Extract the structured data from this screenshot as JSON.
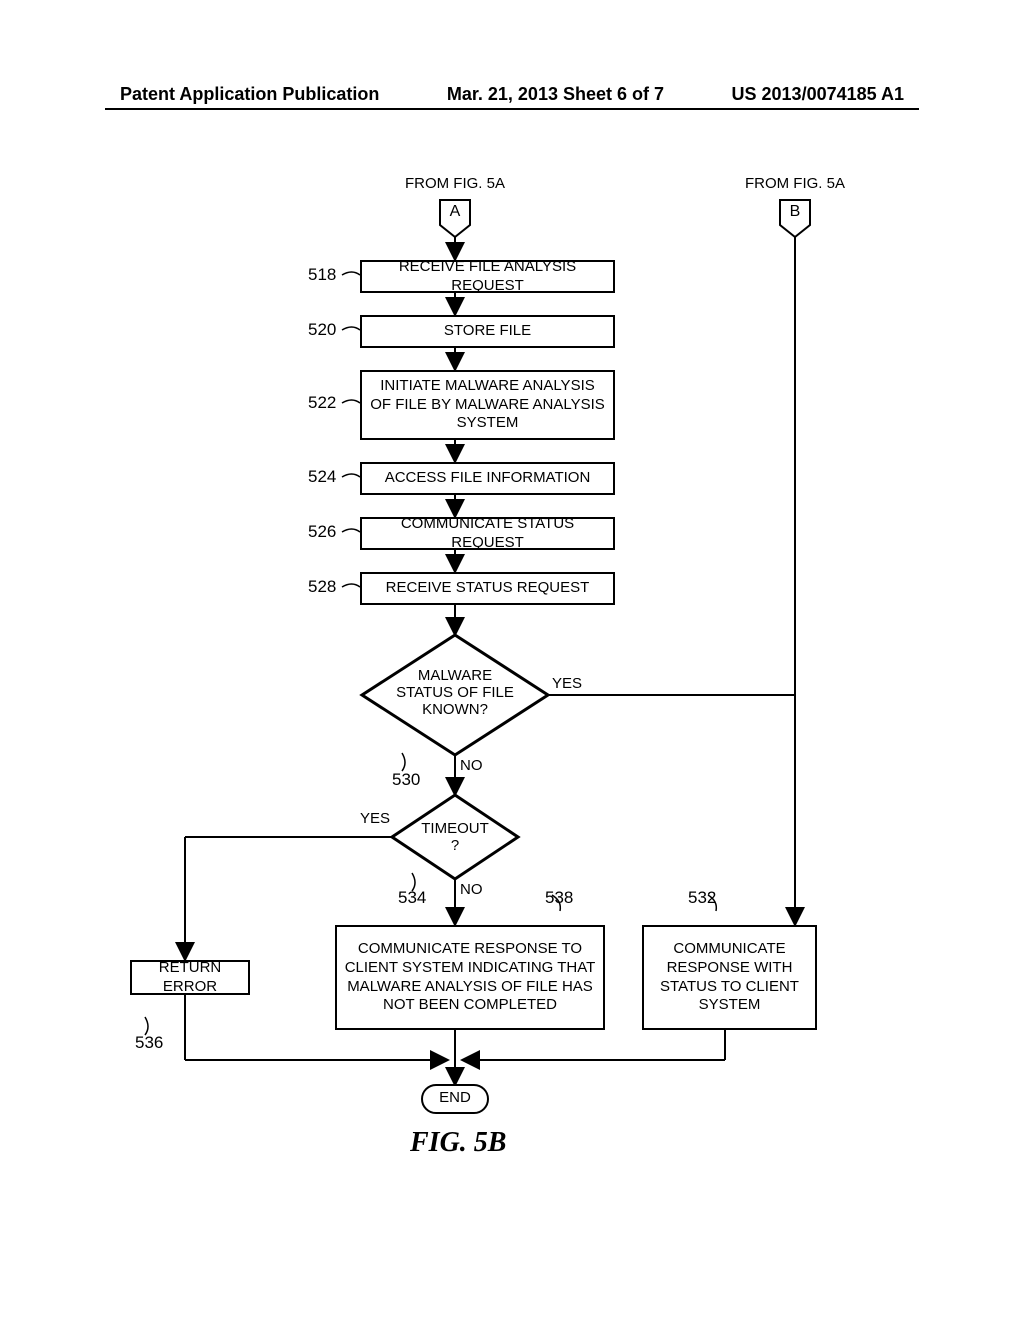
{
  "header": {
    "left": "Patent Application Publication",
    "center": "Mar. 21, 2013  Sheet 6 of 7",
    "right": "US 2013/0074185 A1"
  },
  "labels": {
    "fromA": "FROM FIG. 5A",
    "fromB": "FROM FIG. 5A",
    "connA": "A",
    "connB": "B"
  },
  "steps": {
    "s518": "RECEIVE FILE ANALYSIS REQUEST",
    "s520": "STORE FILE",
    "s522": "INITIATE MALWARE ANALYSIS OF FILE BY MALWARE ANALYSIS SYSTEM",
    "s524": "ACCESS FILE INFORMATION",
    "s526": "COMMUNICATE STATUS REQUEST",
    "s528": "RECEIVE STATUS REQUEST",
    "d530": "MALWARE STATUS OF FILE KNOWN?",
    "d534": "TIMEOUT\n?",
    "s538": "COMMUNICATE RESPONSE TO CLIENT SYSTEM INDICATING THAT MALWARE ANALYSIS OF FILE HAS NOT BEEN COMPLETED",
    "s532": "COMMUNICATE RESPONSE WITH STATUS TO CLIENT SYSTEM",
    "s536": "RETURN ERROR",
    "end": "END",
    "fig": "FIG. 5B"
  },
  "refs": {
    "r518": "518",
    "r520": "520",
    "r522": "522",
    "r524": "524",
    "r526": "526",
    "r528": "528",
    "r530": "530",
    "r534": "534",
    "r538": "538",
    "r532": "532",
    "r536": "536"
  },
  "branches": {
    "yes": "YES",
    "no": "NO"
  }
}
